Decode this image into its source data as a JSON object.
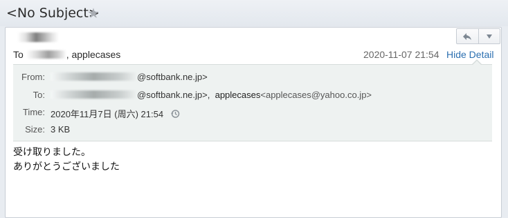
{
  "header": {
    "subject": "<No Subject>",
    "star_icon": "star-icon"
  },
  "message": {
    "to_prefix": "To",
    "to_visible": "applecases",
    "date": "2020-11-07 21:54",
    "hide_detail": "Hide Detail",
    "reply_icon": "reply-icon",
    "more_icon": "chevron-down-icon"
  },
  "details": {
    "from_label": "From:",
    "from_value": "@softbank.ne.jp>",
    "to_label": "To:",
    "to_value1": "@softbank.ne.jp>,",
    "to_name2": "applecases",
    "to_email2": "<applecases@yahoo.co.jp>",
    "time_label": "Time:",
    "time_value": "2020年11月7日 (周六) 21:54",
    "size_label": "Size:",
    "size_value": "3 KB",
    "history_icon": "history-icon"
  },
  "body": {
    "line1": "受け取りました。",
    "line2": "ありがとうございました"
  }
}
